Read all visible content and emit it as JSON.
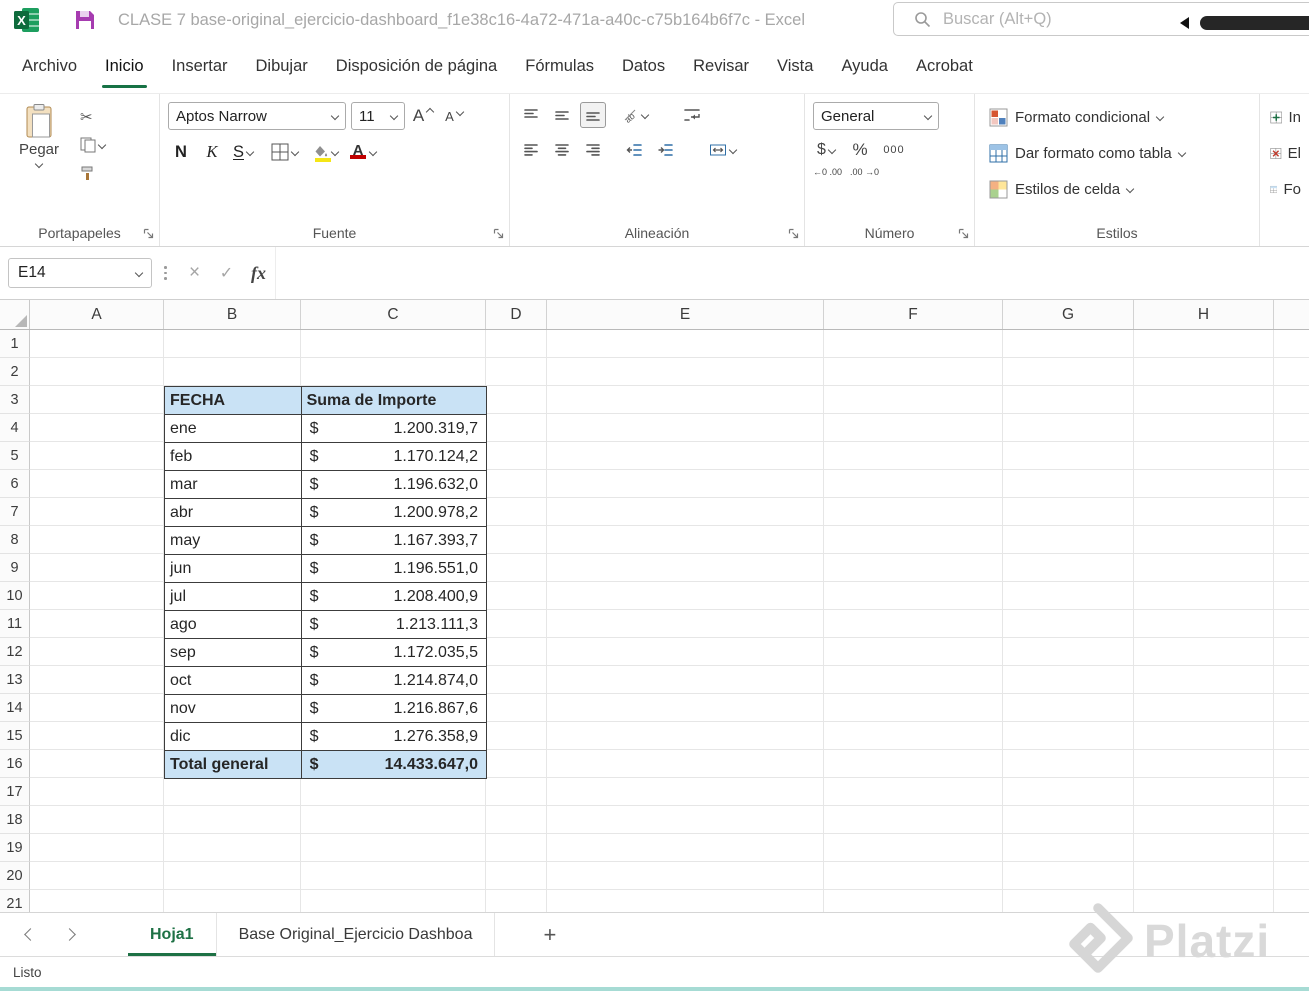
{
  "titlebar": {
    "app_title": "CLASE 7 base-original_ejercicio-dashboard_f1e38c16-4a72-471a-a40c-c75b164b6f7c  -  Excel",
    "search_placeholder": "Buscar (Alt+Q)"
  },
  "menu_tabs": [
    {
      "label": "Archivo",
      "active": false
    },
    {
      "label": "Inicio",
      "active": true
    },
    {
      "label": "Insertar",
      "active": false
    },
    {
      "label": "Dibujar",
      "active": false
    },
    {
      "label": "Disposición de página",
      "active": false
    },
    {
      "label": "Fórmulas",
      "active": false
    },
    {
      "label": "Datos",
      "active": false
    },
    {
      "label": "Revisar",
      "active": false
    },
    {
      "label": "Vista",
      "active": false
    },
    {
      "label": "Ayuda",
      "active": false
    },
    {
      "label": "Acrobat",
      "active": false
    }
  ],
  "ribbon": {
    "clipboard": {
      "paste": "Pegar",
      "group": "Portapapeles"
    },
    "font": {
      "name": "Aptos Narrow",
      "size": "11",
      "grow": "A",
      "shrink": "A",
      "bold": "N",
      "italic": "K",
      "underline": "S",
      "group": "Fuente"
    },
    "alignment": {
      "group": "Alineación"
    },
    "number": {
      "format": "General",
      "currency": "$",
      "percent": "%",
      "comma": "000",
      "increase_decimal": "←0 .00",
      "decrease_decimal": ".00 →0",
      "group": "Número"
    },
    "styles": {
      "conditional": "Formato condicional",
      "format_table": "Dar formato como tabla",
      "cell_styles": "Estilos de celda",
      "group": "Estilos"
    },
    "cells_clipped": [
      "In",
      "El",
      "Fo"
    ]
  },
  "formula_bar": {
    "name_box": "E14",
    "fx": "fx"
  },
  "grid": {
    "col_headers": [
      "A",
      "B",
      "C",
      "D",
      "E",
      "F",
      "G",
      "H"
    ],
    "row_headers": [
      "1",
      "2",
      "3",
      "4",
      "5",
      "6",
      "7",
      "8",
      "9",
      "10",
      "11",
      "12",
      "13",
      "14",
      "15",
      "16",
      "17",
      "18",
      "19",
      "20",
      "21"
    ]
  },
  "pivot": {
    "col1_header": "FECHA",
    "col2_header": "Suma de Importe",
    "currency": "$",
    "rows": [
      {
        "label": "ene",
        "value": "1.200.319,7"
      },
      {
        "label": "feb",
        "value": "1.170.124,2"
      },
      {
        "label": "mar",
        "value": "1.196.632,0"
      },
      {
        "label": "abr",
        "value": "1.200.978,2"
      },
      {
        "label": "may",
        "value": "1.167.393,7"
      },
      {
        "label": "jun",
        "value": "1.196.551,0"
      },
      {
        "label": "jul",
        "value": "1.208.400,9"
      },
      {
        "label": "ago",
        "value": "1.213.111,3"
      },
      {
        "label": "sep",
        "value": "1.172.035,5"
      },
      {
        "label": "oct",
        "value": "1.214.874,0"
      },
      {
        "label": "nov",
        "value": "1.216.867,6"
      },
      {
        "label": "dic",
        "value": "1.276.358,9"
      }
    ],
    "total_label": "Total general",
    "total_value": "14.433.647,0"
  },
  "sheet_bar": {
    "tabs": [
      {
        "label": "Hoja1",
        "active": true
      },
      {
        "label": "Base Original_Ejercicio Dashboa",
        "active": false
      }
    ],
    "add": "+"
  },
  "status_bar": {
    "mode": "Listo"
  },
  "watermark": "Platzi",
  "colors": {
    "excel_green": "#107C41",
    "tab_underline": "#177245",
    "table_header_blue": "#C9E2F5",
    "fill_yellow": "#F5E616",
    "font_color_red": "#C00000",
    "save_icon_purple": "#A63BB0"
  }
}
